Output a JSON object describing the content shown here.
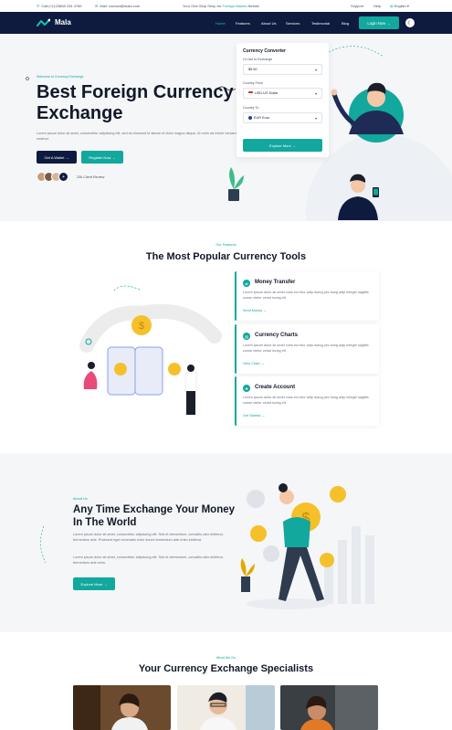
{
  "topbar": {
    "phone": "Call:(+)123658 234 4789",
    "mail": "Mail: contact@mala.com",
    "slogan_pre": "Your One Stop Shop for ",
    "slogan_hl": "Foreign Blanes",
    "slogan_post": " Needs!",
    "support": "Support",
    "help": "Help",
    "language": "English"
  },
  "header": {
    "logo": "Mala",
    "nav": [
      "Home",
      "Features",
      "About Us",
      "Services",
      "Testimonial",
      "Blog"
    ],
    "login": "Login Now",
    "colors": {
      "navy": "#0e1b3f",
      "teal": "#12a89d"
    }
  },
  "hero": {
    "tag": "Welcome to Currency Exchange",
    "title": "Best Foreign Currency Exchange",
    "description": "Lorem ipsum dolor sit amet, consectetur adipiscing elit, sed do eiusmod te labore et dolor magna aliqua. Ut enim ad minim veniam, quis nostrud.",
    "btn_wallet": "Get A Wallet",
    "btn_register": "Register Now",
    "review": "23k Client Review"
  },
  "converter": {
    "title": "Currency Converter",
    "amount_label": "I'd Like to Exchange",
    "amount_value": "$5.90",
    "from_label": "Country From",
    "from_value": "USD-US Dollar",
    "to_label": "Country To",
    "to_value": "EUR Euro",
    "button": "Explore More"
  },
  "tools": {
    "tag": "Our Features",
    "title": "The Most Popular Currency Tools",
    "cards": [
      {
        "title": "Money Transfer",
        "desc": "Lorem ipsum dolor sit amet cons ect etur adip iscing pec tiung adip integer sagittis conse ctetur cedut iscing elt.",
        "link": "Send Money"
      },
      {
        "title": "Currency Charts",
        "desc": "Lorem ipsum dolor sit amet cons ect etur adip iscing pec tiung adip integer sagittis conse ctetur cedut iscing elt.",
        "link": "View Chart"
      },
      {
        "title": "Create Account",
        "desc": "Lorem ipsum dolor sit amet cons ect etur adip iscing pec tiung adip integer sagittis conse ctetur cedut iscing elt.",
        "link": "Get Started"
      }
    ]
  },
  "about": {
    "tag": "About Us",
    "title": "Any Time Exchange Your Money In The World",
    "p1": "Lorem ipsum dolor sit amet, consectetur adipiscing elit. Sed et elementum, convallis odio eleifend, fermentum arte. Praesent eget venenatis enim donec fermentum arte enim eleifend.",
    "p2": "Lorem ipsum dolor sit amet, consectetur adipiscing elit. Sed et elementum, convallis odio eleifend, fermentum arte enim.",
    "button": "Explore More"
  },
  "team": {
    "tag": "What We Do",
    "title": "Your Currency Exchange Specialists"
  }
}
